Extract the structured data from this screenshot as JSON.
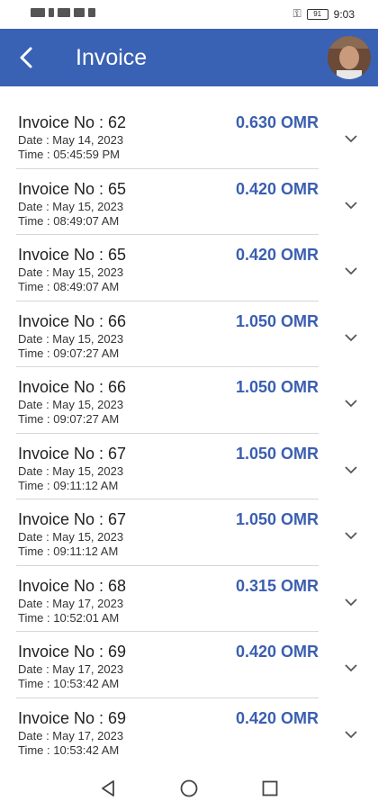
{
  "status": {
    "time": "9:03",
    "battery": "91"
  },
  "header": {
    "title": "Invoice"
  },
  "invoices": [
    {
      "no": "Invoice No : 62",
      "date": "Date : May 14, 2023",
      "time": "Time : 05:45:59 PM",
      "amount": "0.630 OMR"
    },
    {
      "no": "Invoice No : 65",
      "date": "Date : May 15, 2023",
      "time": "Time : 08:49:07 AM",
      "amount": "0.420 OMR"
    },
    {
      "no": "Invoice No : 65",
      "date": "Date : May 15, 2023",
      "time": "Time : 08:49:07 AM",
      "amount": "0.420 OMR"
    },
    {
      "no": "Invoice No : 66",
      "date": "Date : May 15, 2023",
      "time": "Time : 09:07:27 AM",
      "amount": "1.050 OMR"
    },
    {
      "no": "Invoice No : 66",
      "date": "Date : May 15, 2023",
      "time": "Time : 09:07:27 AM",
      "amount": "1.050 OMR"
    },
    {
      "no": "Invoice No : 67",
      "date": "Date : May 15, 2023",
      "time": "Time : 09:11:12 AM",
      "amount": "1.050 OMR"
    },
    {
      "no": "Invoice No : 67",
      "date": "Date : May 15, 2023",
      "time": "Time : 09:11:12 AM",
      "amount": "1.050 OMR"
    },
    {
      "no": "Invoice No : 68",
      "date": "Date : May 17, 2023",
      "time": "Time : 10:52:01 AM",
      "amount": "0.315 OMR"
    },
    {
      "no": "Invoice No : 69",
      "date": "Date : May 17, 2023",
      "time": "Time : 10:53:42 AM",
      "amount": "0.420 OMR"
    },
    {
      "no": "Invoice No : 69",
      "date": "Date : May 17, 2023",
      "time": "Time : 10:53:42 AM",
      "amount": "0.420 OMR"
    }
  ],
  "icons": {
    "back": "back-arrow-icon",
    "expand": "chevron-down-icon",
    "nav_back": "nav-back-icon",
    "nav_home": "nav-home-icon",
    "nav_recents": "nav-recents-icon"
  },
  "colors": {
    "appbar": "#3a62b4",
    "amount": "#3a5fb0"
  }
}
